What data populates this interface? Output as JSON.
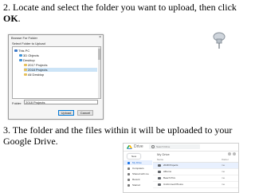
{
  "slide": {
    "step2": {
      "lead": "2. Locate and select the folder you want to upload, then click ",
      "bold": "OK",
      "tail": "."
    },
    "step3": "3. The folder and the files within it will be uploaded to your Google Drive."
  },
  "dialog": {
    "title": "Browse For Folder",
    "close": "×",
    "subtitle": "Select Folder to Upload",
    "tree": [
      {
        "label": "This PC",
        "icon": "pc-icon"
      },
      {
        "label": "3D Objects",
        "icon": "folder-icon"
      },
      {
        "label": "Desktop",
        "icon": "folder-icon"
      },
      {
        "label": "2017 Projects",
        "icon": "folder-icon"
      },
      {
        "label": "2018 Projects",
        "icon": "folder-icon",
        "selected": true
      },
      {
        "label": "All Desktop",
        "icon": "folder-icon"
      }
    ],
    "folder_label": "Folder:",
    "folder_value": "2018 Projects",
    "upload_label": "Upload",
    "cancel_label": "Cancel"
  },
  "drive": {
    "name": "Drive",
    "search_placeholder": "Search Drive",
    "new_label": "New",
    "sidebar": [
      {
        "label": "My Drive",
        "active": true
      },
      {
        "label": "Computers"
      },
      {
        "label": "Shared with me"
      },
      {
        "label": "Recent"
      },
      {
        "label": "Starred"
      }
    ],
    "breadcrumb": "My Drive",
    "columns": {
      "name": "Name",
      "owner": "Owner"
    },
    "files": [
      {
        "name": "2018 Projects",
        "owner": "me",
        "selected": true
      },
      {
        "name": "Albums",
        "owner": "me"
      },
      {
        "name": "Beach Pics",
        "owner": "me"
      },
      {
        "name": "Untrimmed Photos",
        "owner": "me"
      }
    ]
  },
  "colors": {
    "selection": "#cce4f7",
    "drive_blue": "#1a73e8",
    "folder": "#e7c05b"
  }
}
